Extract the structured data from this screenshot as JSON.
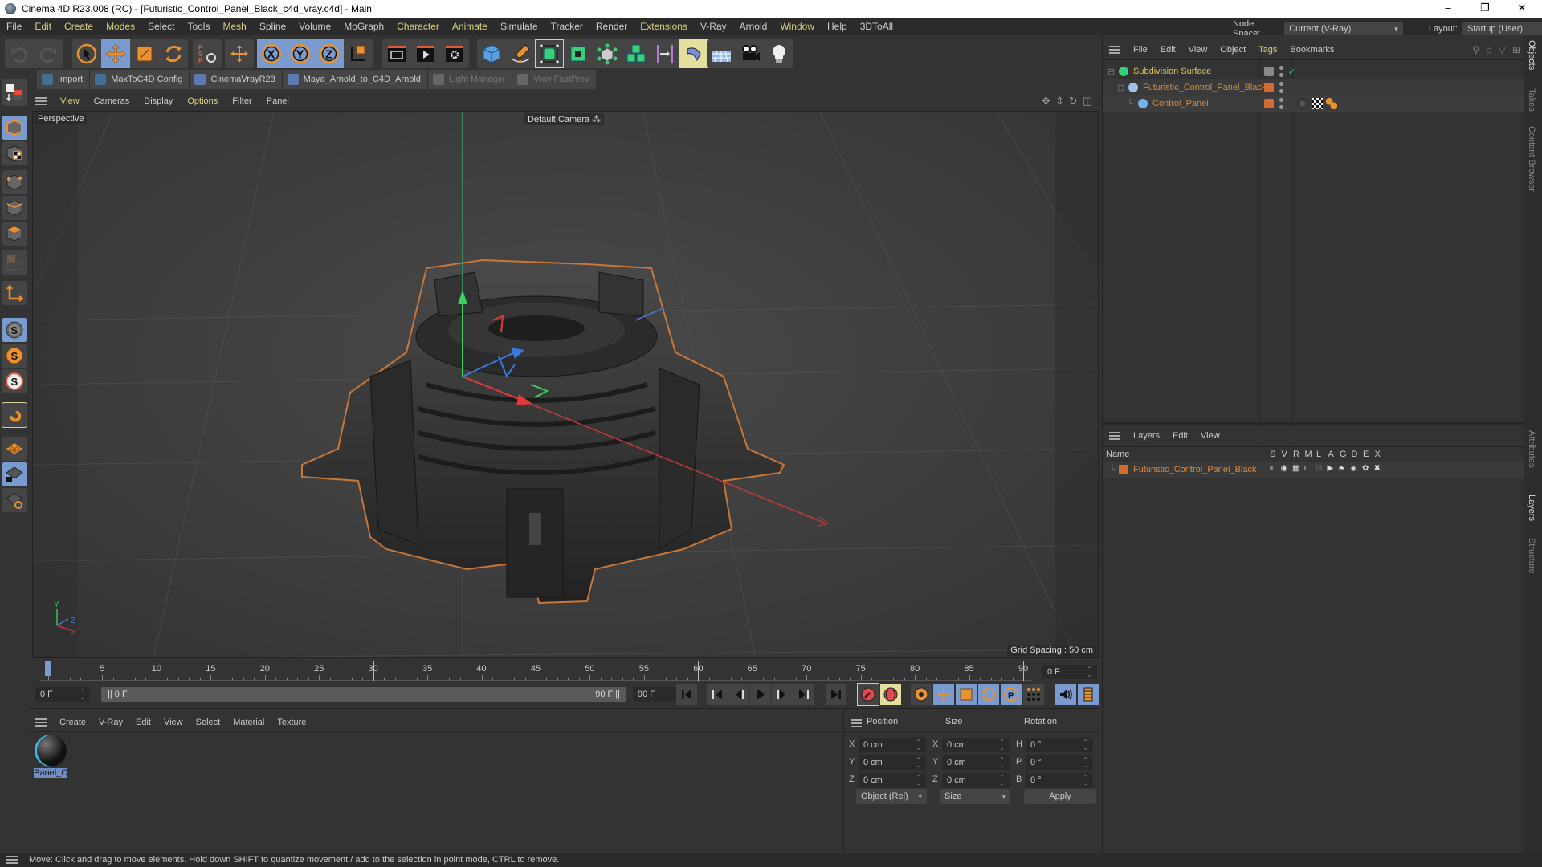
{
  "window": {
    "title": "Cinema 4D R23.008 (RC) - [Futuristic_Control_Panel_Black_c4d_vray.c4d] - Main",
    "controls": {
      "minimize": "–",
      "maximize": "❐",
      "close": "✕"
    }
  },
  "menubar": {
    "items": [
      "File",
      "Edit",
      "Create",
      "Modes",
      "Select",
      "Tools",
      "Mesh",
      "Spline",
      "Volume",
      "MoGraph",
      "Character",
      "Animate",
      "Simulate",
      "Tracker",
      "Render",
      "Extensions",
      "V-Ray",
      "Arnold",
      "Window",
      "Help",
      "3DToAll"
    ],
    "highlighted": [
      "Edit",
      "Create",
      "Modes",
      "Mesh",
      "Character",
      "Animate",
      "Extensions",
      "Window"
    ],
    "node_space_label": "Node Space:",
    "node_space_value": "Current (V-Ray)",
    "layout_label": "Layout:",
    "layout_value": "Startup (User)"
  },
  "toolbar": {
    "groups": [
      [
        "undo-icon",
        "redo-icon"
      ],
      [
        "live-selection-icon",
        "move-icon",
        "scale-icon",
        "rotate-icon"
      ],
      [
        "psr-reset-icon"
      ],
      [
        "world-axis-icon"
      ],
      [
        "x-axis-lock-icon",
        "y-axis-lock-icon",
        "z-axis-lock-icon"
      ],
      [
        "coordinate-system-icon"
      ],
      [
        "render-view-icon",
        "render-picture-viewer-icon",
        "render-settings-icon"
      ],
      [
        "cube-primitive-icon",
        "pen-spline-icon",
        "subdivision-surface-icon",
        "extrude-icon",
        "array-icon",
        "cloner-icon",
        "symmetry-icon",
        "bend-deformer-icon"
      ],
      [
        "floor-icon",
        "camera-icon",
        "light-icon"
      ]
    ]
  },
  "scriptbar": {
    "items": [
      {
        "label": "Import",
        "icon": "import-icon",
        "enabled": true
      },
      {
        "label": "MaxToC4D Config",
        "icon": "wrench-icon",
        "enabled": true
      },
      {
        "label": "CinemaVrayR23",
        "icon": "python-icon",
        "enabled": true
      },
      {
        "label": "Maya_Arnold_to_C4D_Arnold",
        "icon": "python-icon",
        "enabled": true
      },
      {
        "label": "Light Manager",
        "icon": "light-manager-icon",
        "enabled": false
      },
      {
        "label": "Vray FastPrev",
        "icon": "vray-fastprev-icon",
        "enabled": false
      }
    ]
  },
  "left_toolbar": {
    "items": [
      "make-editable-icon",
      "model-mode-icon",
      "texture-mode-icon",
      "point-mode-icon",
      "edge-mode-icon",
      "polygon-mode-icon",
      "uv-mode-icon",
      "axis-mode-icon",
      "solo-off-icon",
      "solo-single-icon",
      "solo-hierarchy-icon",
      "snap-magnet-icon",
      "workplane-icon",
      "workplane-lock-icon",
      "workplane-align-icon"
    ]
  },
  "viewport": {
    "menu": [
      "View",
      "Cameras",
      "Display",
      "Options",
      "Filter",
      "Panel"
    ],
    "menu_highlighted": [
      "View",
      "Options"
    ],
    "projection_label": "Perspective",
    "camera_label": "Default Camera",
    "grid_spacing": "Grid Spacing : 50 cm",
    "axis_labels": {
      "x": "X",
      "y": "Y",
      "z": "Z"
    },
    "nav_icons": [
      "pan-icon",
      "dolly-icon",
      "orbit-icon",
      "maximize-view-icon"
    ]
  },
  "object_manager": {
    "menu": [
      "File",
      "Edit",
      "View",
      "Object",
      "Tags",
      "Bookmarks"
    ],
    "menu_highlighted": [
      "Tags"
    ],
    "objects": [
      {
        "name": "Subdivision Surface",
        "depth": 0,
        "icon": "subdivision-surface-icon",
        "color": "#e6c15c",
        "enabled_check": true
      },
      {
        "name": "Futuristic_Control_Panel_Black",
        "depth": 1,
        "icon": "null-object-icon",
        "color": "#d08a45",
        "layer_color": "#d36b2c"
      },
      {
        "name": "Control_Panel",
        "depth": 2,
        "icon": "polygon-object-icon",
        "color": "#d08a45",
        "layer_color": "#d36b2c",
        "tags": [
          "vray-material-tag-icon",
          "texture-tag-icon",
          "phong-tag-icon"
        ]
      }
    ]
  },
  "layer_manager": {
    "menu": [
      "Layers",
      "Edit",
      "View"
    ],
    "columns": [
      "Name",
      "S",
      "V",
      "R",
      "M",
      "L",
      "A",
      "G",
      "D",
      "E",
      "X"
    ],
    "layers": [
      {
        "name": "Futuristic_Control_Panel_Black",
        "color": "#d36b2c"
      }
    ]
  },
  "side_tabs": {
    "top": [
      "Objects",
      "Takes",
      "Content Browser"
    ],
    "bottom": [
      "Attributes",
      "Layers",
      "Structure"
    ],
    "active": [
      "Objects",
      "Layers"
    ]
  },
  "timeline": {
    "ticks": [
      0,
      5,
      10,
      15,
      20,
      25,
      30,
      35,
      40,
      45,
      50,
      55,
      60,
      65,
      70,
      75,
      80,
      85,
      90
    ],
    "current_frame": 0,
    "end_frame_field": "0 F",
    "start_field": "0 F",
    "range_start": "0 F",
    "range_end": "90 F",
    "max_field": "90 F"
  },
  "playback": {
    "buttons": [
      "go-to-start-icon",
      "go-to-prev-key-icon",
      "step-back-icon",
      "play-icon",
      "step-forward-icon",
      "go-to-next-key-icon",
      "go-to-end-icon"
    ],
    "record_buttons": [
      "record-keys-icon",
      "auto-keying-icon"
    ],
    "key_buttons": [
      "keyframe-selection-icon",
      "key-position-icon",
      "key-scale-icon",
      "key-rotation-icon",
      "key-parameter-icon",
      "key-pla-icon"
    ],
    "extra_buttons": [
      "sound-icon",
      "timeline-icon"
    ]
  },
  "material_manager": {
    "menu": [
      "Create",
      "V-Ray",
      "Edit",
      "View",
      "Select",
      "Material",
      "Texture"
    ],
    "materials": [
      {
        "name": "Panel_Co"
      }
    ]
  },
  "coordinates": {
    "headers": {
      "position": "Position",
      "size": "Size",
      "rotation": "Rotation"
    },
    "rows": [
      {
        "axis": "X",
        "position": "0 cm",
        "size_axis": "X",
        "size": "0 cm",
        "rot_axis": "H",
        "rotation": "0 °"
      },
      {
        "axis": "Y",
        "position": "0 cm",
        "size_axis": "Y",
        "size": "0 cm",
        "rot_axis": "P",
        "rotation": "0 °"
      },
      {
        "axis": "Z",
        "position": "0 cm",
        "size_axis": "Z",
        "size": "0 cm",
        "rot_axis": "B",
        "rotation": "0 °"
      }
    ],
    "mode_dropdown": "Object (Rel)",
    "size_dropdown": "Size",
    "apply_label": "Apply"
  },
  "statusbar": {
    "text": "Move: Click and drag to move elements. Hold down SHIFT to quantize movement / add to the selection in point mode, CTRL to remove."
  }
}
